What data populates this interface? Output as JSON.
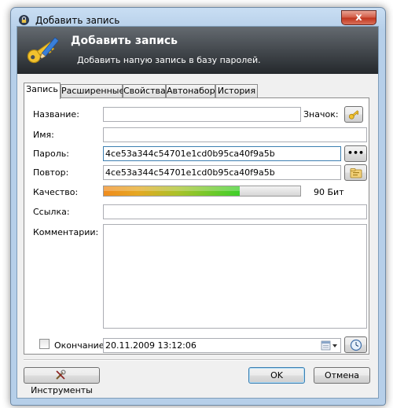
{
  "window": {
    "title": "Добавить запись",
    "close_label": "x"
  },
  "banner": {
    "title": "Добавить запись",
    "subtitle": "Добавить напую запись в базу паролей."
  },
  "tabs": [
    {
      "label": "Запись",
      "active": true
    },
    {
      "label": "Расширенные",
      "active": false
    },
    {
      "label": "Свойства",
      "active": false
    },
    {
      "label": "Автонабор",
      "active": false
    },
    {
      "label": "История",
      "active": false
    }
  ],
  "form": {
    "title_label": "Название:",
    "title_value": "",
    "icon_label": "Значок:",
    "user_label": "Имя:",
    "user_value": "",
    "password_label": "Пароль:",
    "password_value": "4ce53a344c54701e1cd0b95ca40f9a5b",
    "show_password_label": "•••",
    "repeat_label": "Повтор:",
    "repeat_value": "4ce53a344c54701e1cd0b95ca40f9a5b",
    "quality_label": "Качество:",
    "quality_fraction": 0.69,
    "quality_text": "90 Бит",
    "url_label": "Ссылка:",
    "url_value": "",
    "notes_label": "Комментарии:",
    "notes_value": "",
    "expires_label": "Окончание:",
    "expires_checked": false,
    "expires_value": "20.11.2009 13:12:06"
  },
  "footer": {
    "tools_label": "Инструменты",
    "ok_label": "OK",
    "cancel_label": "Отмена"
  },
  "colors": {
    "banner_top": "#646a70",
    "banner_bottom": "#24282c",
    "quality_start": "#f08c1e",
    "quality_end": "#3ecf2a",
    "close_button": "#c0331c"
  },
  "icons": {
    "title": "lock-icon",
    "banner": "key-pen-icon",
    "icon_picker": "key-icon",
    "show_password": "dots-icon",
    "generate_password": "password-generator-icon",
    "calendar": "calendar-icon",
    "expiry_presets": "clock-icon",
    "tools": "tools-icon"
  }
}
